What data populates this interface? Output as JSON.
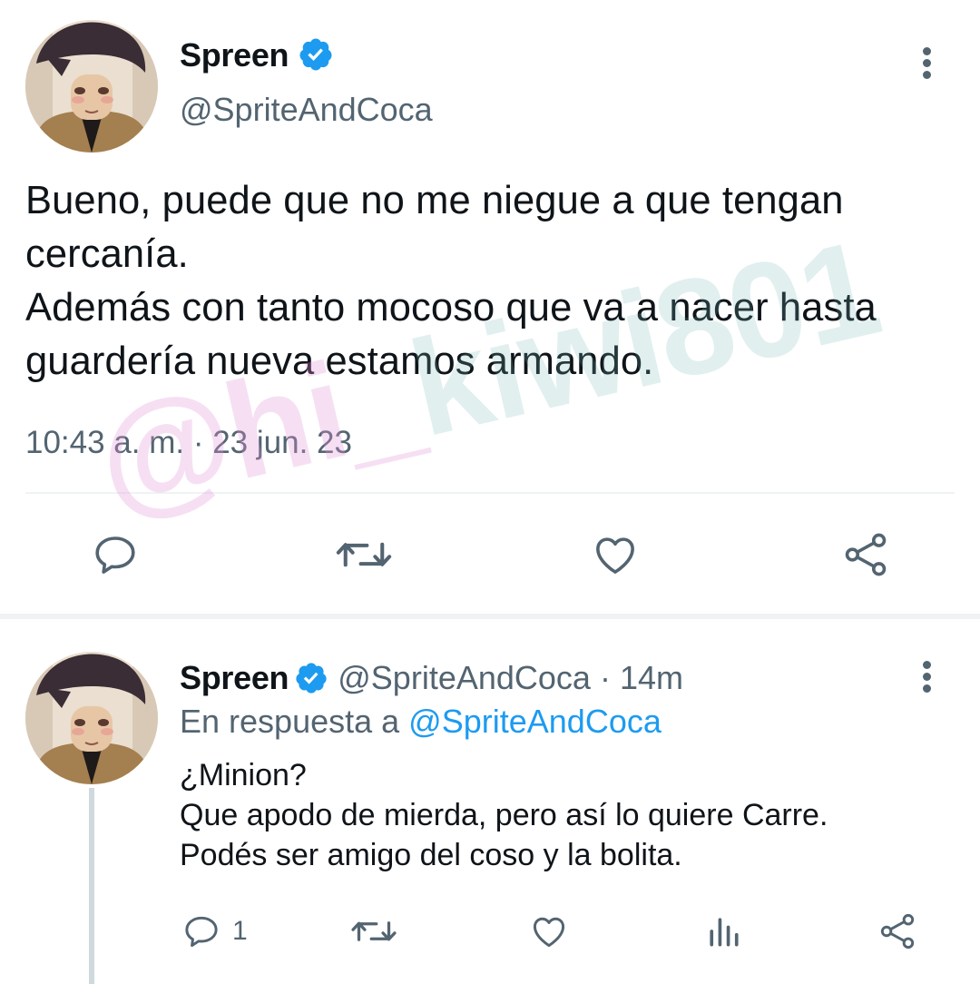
{
  "main_tweet": {
    "author_name": "Spreen",
    "author_handle": "@SpriteAndCoca",
    "text": "Bueno, puede que no me niegue a que tengan cercanía.\nAdemás con tanto mocoso que va a nacer hasta guardería nueva estamos armando.",
    "timestamp": "10:43 a. m. · 23 jun. 23",
    "icons": {
      "verified": "verified-badge-icon",
      "more": "kebab-menu-icon",
      "reply": "reply-icon",
      "retweet": "retweet-icon",
      "like": "like-icon",
      "share": "share-icon"
    }
  },
  "reply_tweet": {
    "author_name": "Spreen",
    "author_handle": "@SpriteAndCoca",
    "separator": "·",
    "time_ago": "14m",
    "replying_prefix": "En respuesta a",
    "replying_to": "@SpriteAndCoca",
    "text": "¿Minion?\nQue apodo de mierda, pero así lo quiere Carre.\nPodés ser amigo del coso y la bolita.",
    "reply_count": "1",
    "icons": {
      "reply": "reply-icon",
      "retweet": "retweet-icon",
      "like": "like-icon",
      "stats": "analytics-icon",
      "share": "share-icon"
    }
  },
  "watermark": {
    "part1": "@hi_",
    "part2": "kiwi801"
  },
  "colors": {
    "text": "#0f1419",
    "secondary": "#536471",
    "accent": "#1d9bf0",
    "divider": "#eff3f4",
    "thread_line": "#cfd9de"
  }
}
